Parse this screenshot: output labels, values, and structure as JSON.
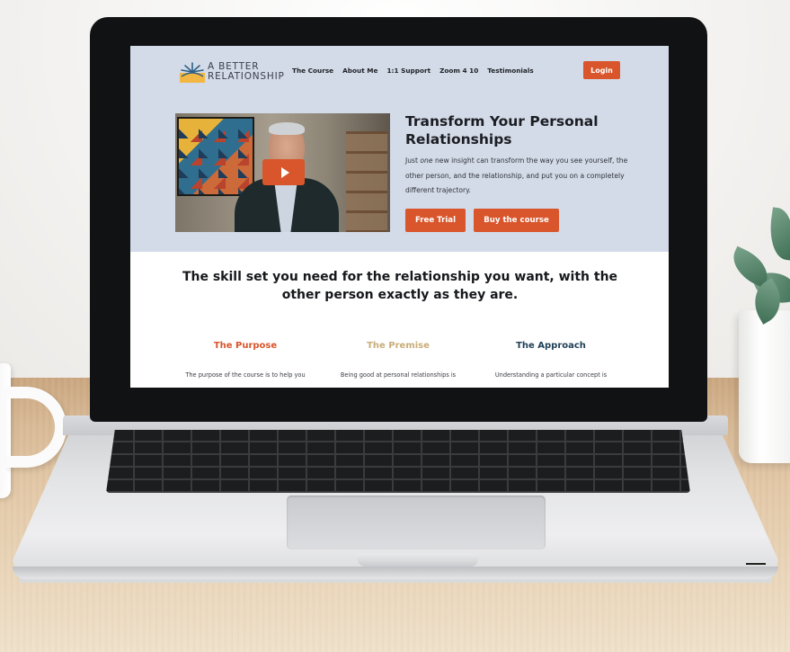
{
  "brand": {
    "line1": "A BETTER",
    "line2": "RELATIONSHIP",
    "colors": {
      "accent": "#d9552b",
      "hero_bg": "#d3dbe8",
      "premise": "#c8ad78",
      "approach": "#1f4057"
    }
  },
  "nav": {
    "items": [
      "The Course",
      "About Me",
      "1:1 Support",
      "Zoom 4 10",
      "Testimonials"
    ],
    "login_label": "Login"
  },
  "hero": {
    "title": "Transform Your Personal Relationships",
    "body_prefix": "Just ",
    "body_emphasis": "one",
    "body_suffix": " new insight can transform the way you see yourself, the other person, and the relationship, and put you on a completely different trajectory.",
    "free_trial_label": "Free Trial",
    "buy_label": "Buy the course",
    "video_play_icon": "play-icon"
  },
  "section": {
    "headline": "The skill set you need for the relationship you want, with the other person exactly as they are.",
    "columns": [
      {
        "title": "The Purpose",
        "text": "The purpose of the course is to help you"
      },
      {
        "title": "The Premise",
        "text": "Being good at personal relationships is"
      },
      {
        "title": "The Approach",
        "text": "Understanding a particular concept is"
      }
    ]
  }
}
